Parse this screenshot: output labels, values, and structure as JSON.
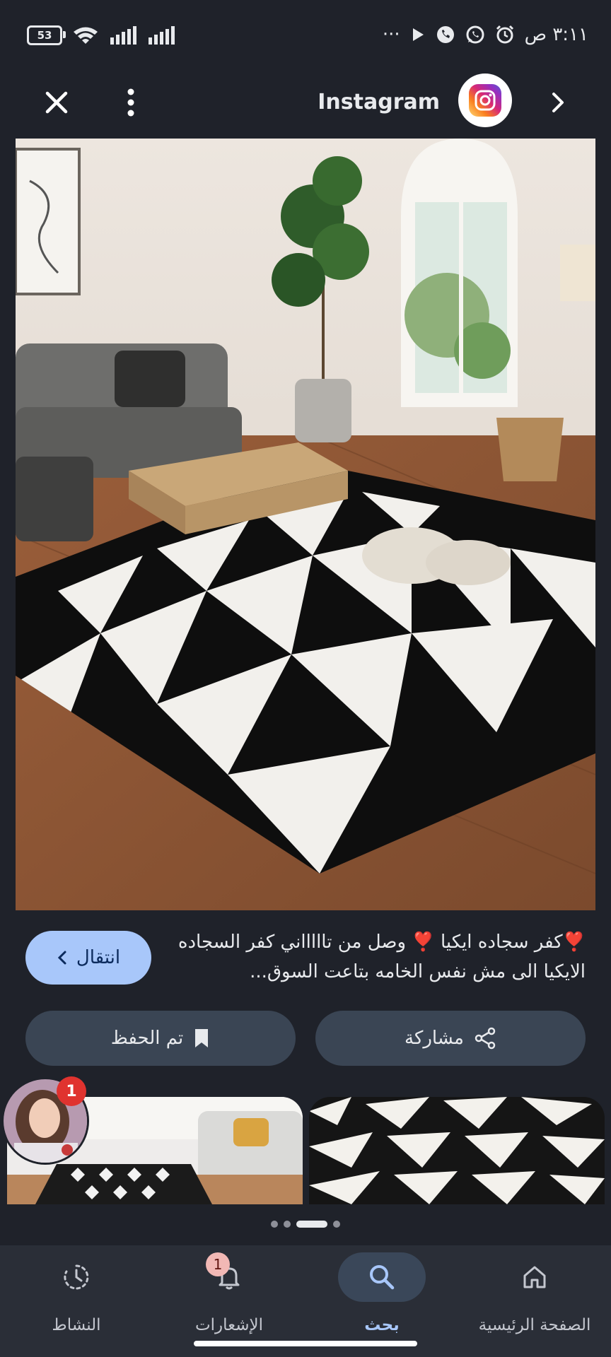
{
  "status_bar": {
    "battery": "53",
    "time": "٣:١١ ص",
    "overflow": "···"
  },
  "header": {
    "source_title": "Instagram",
    "close_icon": "close-icon",
    "more_icon": "more-vert-icon",
    "forward_icon": "chevron-right-icon"
  },
  "caption": {
    "text": "❣️كفر سجاده ايكيا ❣️ وصل من تاااااني كفر السجاده الايكيا الى مش نفس الخامه بتاعت السوق..."
  },
  "buttons": {
    "visit_label": "انتقال",
    "share_label": "مشاركة",
    "saved_label": "تم الحفظ"
  },
  "related": {
    "avatar_badge": "1"
  },
  "bottom_nav": {
    "items": [
      {
        "label": "الصفحة الرئيسية",
        "icon": "home-icon"
      },
      {
        "label": "بحث",
        "icon": "search-icon"
      },
      {
        "label": "الإشعارات",
        "icon": "bell-icon",
        "badge": "1"
      },
      {
        "label": "النشاط",
        "icon": "activity-clock-icon"
      }
    ],
    "active_index": 1
  },
  "colors": {
    "background": "#1f222a",
    "accent": "#a8c7fa",
    "button": "#3a4554",
    "badge": "#e0332f"
  }
}
